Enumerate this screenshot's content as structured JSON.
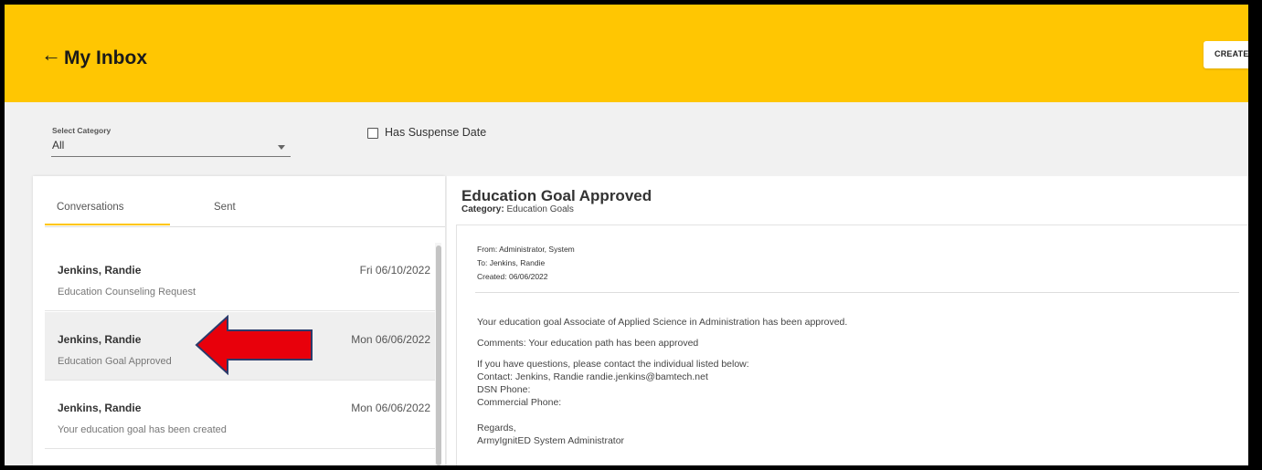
{
  "header": {
    "back_icon": "arrow-left-icon",
    "back_glyph": "←",
    "title": "My Inbox",
    "create_label": "CREATE",
    "accent_color": "#ffc602"
  },
  "filters": {
    "category_label": "Select Category",
    "category_value": "All",
    "suspense_label": "Has Suspense Date",
    "suspense_checked": false
  },
  "tabs": [
    {
      "label": "Conversations",
      "active": true
    },
    {
      "label": "Sent",
      "active": false
    }
  ],
  "messages": [
    {
      "sender": "Jenkins, Randie",
      "date": "Fri 06/10/2022",
      "subject": "Education Counseling Request",
      "selected": false
    },
    {
      "sender": "Jenkins, Randie",
      "date": "Mon 06/06/2022",
      "subject": "Education Goal Approved",
      "selected": true
    },
    {
      "sender": "Jenkins, Randie",
      "date": "Mon 06/06/2022",
      "subject": "Your education goal has been created",
      "selected": false
    }
  ],
  "detail": {
    "title": "Education Goal Approved",
    "category_label": "Category:",
    "category_value": "Education Goals",
    "from": "From: Administrator, System",
    "to": "To: Jenkins, Randie",
    "created": "Created: 06/06/2022",
    "body": [
      "Your education goal Associate of Applied Science in Administration has been approved.",
      "Comments: Your education path has been approved",
      "If you have questions, please contact the individual listed below:",
      "Contact: Jenkins, Randie randie.jenkins@bamtech.net",
      "DSN Phone:",
      "Commercial Phone:",
      "Regards,",
      "ArmyIgnitED System Administrator"
    ]
  },
  "annotation": {
    "arrow_color": "#e8000b"
  }
}
